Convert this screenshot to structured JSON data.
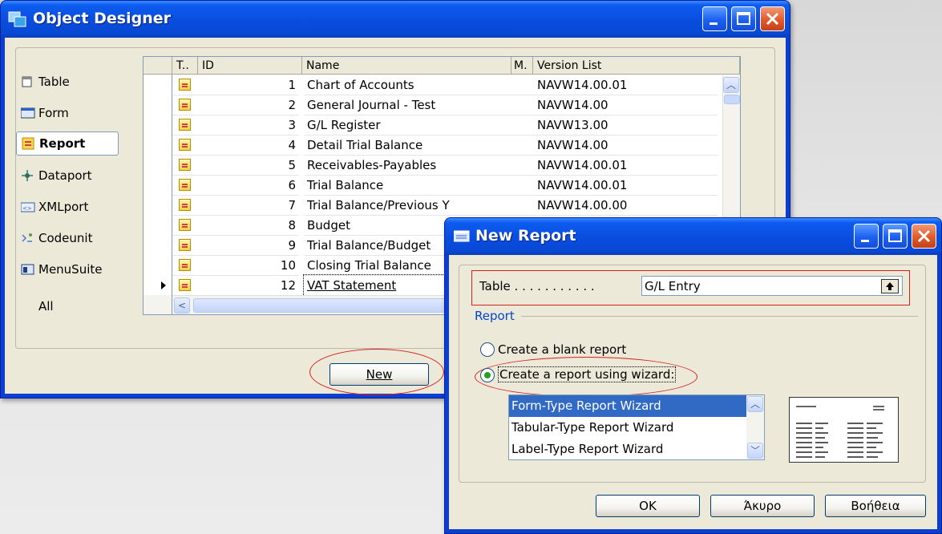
{
  "object_designer": {
    "title": "Object Designer",
    "sidebar": [
      {
        "label": "Table"
      },
      {
        "label": "Form"
      },
      {
        "label": "Report"
      },
      {
        "label": "Dataport"
      },
      {
        "label": "XMLport"
      },
      {
        "label": "Codeunit"
      },
      {
        "label": "MenuSuite"
      },
      {
        "label": "All"
      }
    ],
    "columns": {
      "type": "T..",
      "id": "ID",
      "name": "Name",
      "modified": "M.",
      "version": "Version List"
    },
    "rows": [
      {
        "id": "1",
        "name": "Chart of Accounts",
        "version": "NAVW14.00.01"
      },
      {
        "id": "2",
        "name": "General Journal - Test",
        "version": "NAVW14.00"
      },
      {
        "id": "3",
        "name": "G/L Register",
        "version": "NAVW13.00"
      },
      {
        "id": "4",
        "name": "Detail Trial Balance",
        "version": "NAVW14.00"
      },
      {
        "id": "5",
        "name": "Receivables-Payables",
        "version": "NAVW14.00.01"
      },
      {
        "id": "6",
        "name": "Trial Balance",
        "version": "NAVW14.00.01"
      },
      {
        "id": "7",
        "name": "Trial Balance/Previous Y",
        "version": "NAVW14.00.00"
      },
      {
        "id": "8",
        "name": "Budget",
        "version": ""
      },
      {
        "id": "9",
        "name": "Trial Balance/Budget",
        "version": ""
      },
      {
        "id": "10",
        "name": "Closing Trial Balance",
        "version": ""
      },
      {
        "id": "12",
        "name": "VAT Statement",
        "version": ""
      }
    ],
    "new_button": "New"
  },
  "new_report": {
    "title": "New Report",
    "table_label": "Table . . . . . . . . . . .",
    "table_value": "G/L Entry",
    "section_label": "Report",
    "radio_blank": "Create a blank report",
    "radio_wizard": "Create a report using wizard:",
    "wizards": [
      "Form-Type Report Wizard",
      "Tabular-Type Report Wizard",
      "Label-Type Report Wizard"
    ],
    "ok": "OK",
    "cancel": "Άκυρο",
    "help": "Βοήθεια"
  },
  "colors": {
    "title_blue": "#0a4ee0",
    "face": "#ece9d8",
    "selection": "#316ac5",
    "annotation_red": "#d62020"
  }
}
